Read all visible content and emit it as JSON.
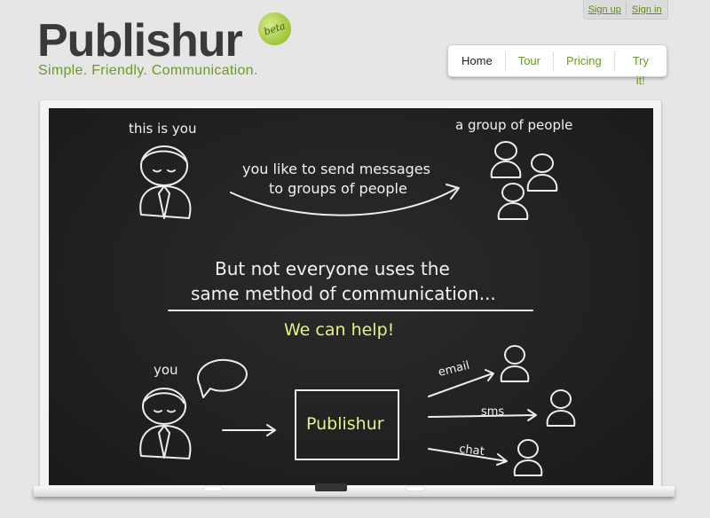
{
  "auth": {
    "signup": "Sign up",
    "signin": "Sign in"
  },
  "logo": {
    "name": "Publishur",
    "badge": "beta",
    "tagline": "Simple. Friendly. Communication."
  },
  "nav": {
    "items": [
      "Home",
      "Tour",
      "Pricing",
      "Try it!"
    ],
    "active": "Home"
  },
  "board": {
    "you_label": "this is you",
    "group_label": "a group of people",
    "send_line1": "you like to send messages",
    "send_line2": "to groups of people",
    "problem_line1": "But not everyone uses the",
    "problem_line2": "same method of communication...",
    "help": "We can help!",
    "you_small": "you",
    "box_label": "Publishur",
    "channel_email": "email",
    "channel_sms": "sms",
    "channel_chat": "chat"
  },
  "colors": {
    "brand_green": "#6d9a24",
    "chalk_yellow": "#e8f08a",
    "board": "#1f1f1f"
  }
}
